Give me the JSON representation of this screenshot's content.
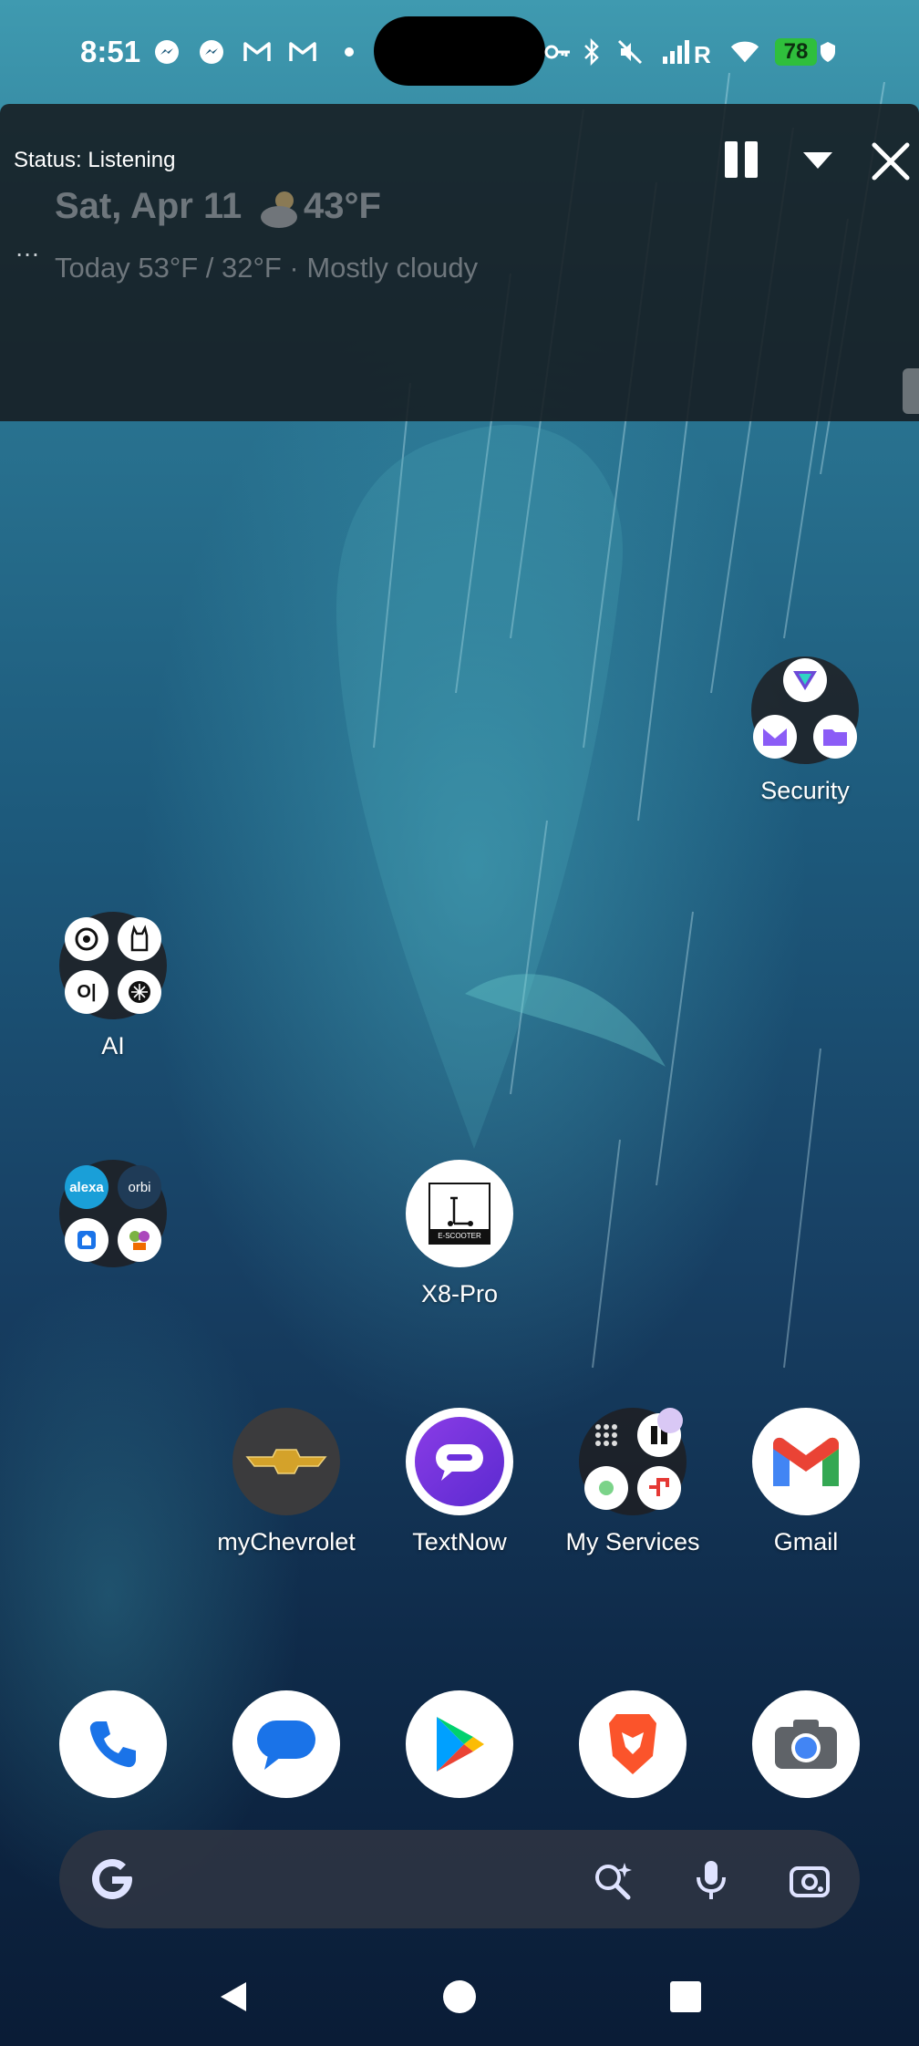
{
  "status_bar": {
    "time": "8:51",
    "battery": "78"
  },
  "overlay": {
    "status_text": "Status: Listening",
    "date": "Sat, Apr 11",
    "temperature": "43°F",
    "forecast": "Today 53°F / 32°F · Mostly cloudy",
    "more": "…",
    "controls": [
      "pause-icon",
      "collapse-icon",
      "close-icon"
    ]
  },
  "home": {
    "security": {
      "label": "Security"
    },
    "ai": {
      "label": "AI"
    },
    "smart_home": {
      "minis": [
        "alexa",
        "orbi"
      ]
    },
    "x8pro": {
      "label": "X8-Pro",
      "badge": "E-SCOOTER"
    },
    "row": [
      {
        "label": "myChevrolet"
      },
      {
        "label": "TextNow"
      },
      {
        "label": "My Services"
      },
      {
        "label": "Gmail"
      }
    ]
  },
  "dock": [
    "phone-icon",
    "messages-icon",
    "play-store-icon",
    "brave-icon",
    "camera-icon"
  ],
  "search": {
    "logo": "G"
  },
  "colors": {
    "accent_battery": "#2fbf3c",
    "overlay_bg": "#161b20"
  }
}
